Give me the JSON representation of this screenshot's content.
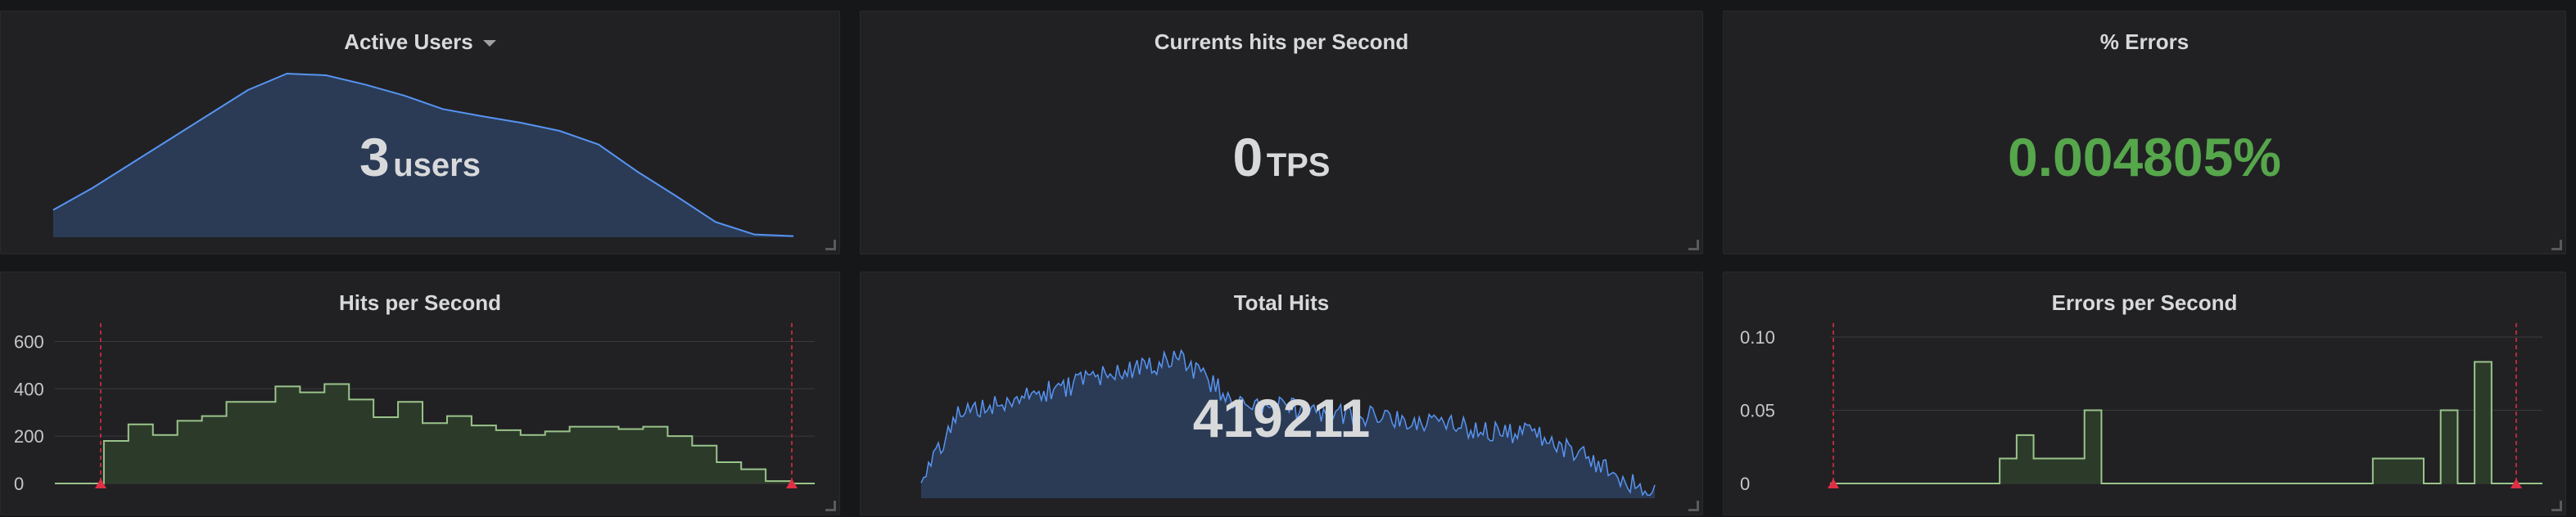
{
  "panels": {
    "active_users": {
      "title": "Active Users",
      "value": "3",
      "unit": "users"
    },
    "current_hits": {
      "title": "Currents hits per Second",
      "value": "0",
      "unit": "TPS"
    },
    "errors_pct": {
      "title": "% Errors",
      "value": "0.004805%",
      "color": "#56a64b"
    },
    "hits_per_second": {
      "title": "Hits per Second"
    },
    "total_hits": {
      "title": "Total Hits",
      "value": "419211"
    },
    "errors_per_second": {
      "title": "Errors per Second"
    }
  },
  "colors": {
    "sparkline_line": "#5794f2",
    "sparkline_fill": "#2b3b55",
    "graph_line": "#9ac48a",
    "graph_fill": "#2c3a2a",
    "annotation": "#e02f44",
    "grid": "#3a3a3d"
  },
  "chart_data": [
    {
      "type": "area",
      "name": "active_users_sparkline",
      "y": [
        0.5,
        0.9,
        1.35,
        1.8,
        2.25,
        2.7,
        3.0,
        2.97,
        2.8,
        2.6,
        2.35,
        2.22,
        2.1,
        1.95,
        1.7,
        1.2,
        0.75,
        0.28,
        0.05,
        0.02
      ]
    },
    {
      "type": "line",
      "title": "Hits per Second",
      "ylim": [
        0,
        650
      ],
      "yticks": [
        "600",
        "400",
        "200",
        "0"
      ],
      "ytick_values": [
        600,
        400,
        200,
        0
      ],
      "y": [
        0,
        0,
        180,
        250,
        205,
        265,
        285,
        345,
        345,
        410,
        385,
        420,
        355,
        280,
        345,
        255,
        285,
        245,
        225,
        205,
        220,
        240,
        240,
        230,
        240,
        200,
        160,
        90,
        60,
        10,
        0
      ],
      "annotations": [
        "start",
        "end"
      ]
    },
    {
      "type": "area",
      "name": "total_hits_sparkline",
      "description_samples": 300
    },
    {
      "type": "line",
      "title": "Errors per Second",
      "ylim": [
        0,
        0.105
      ],
      "yticks": [
        "0.10",
        "0.05",
        "0"
      ],
      "ytick_values": [
        0.1,
        0.05,
        0
      ],
      "y": [
        0,
        0,
        0,
        0,
        0,
        0,
        0,
        0,
        0,
        0,
        0.017,
        0.033,
        0.017,
        0.017,
        0.017,
        0.05,
        0,
        0,
        0,
        0,
        0,
        0,
        0,
        0,
        0,
        0,
        0,
        0,
        0,
        0,
        0,
        0,
        0.017,
        0.017,
        0.017,
        0,
        0.05,
        0,
        0.083,
        0,
        0,
        0
      ],
      "annotations": [
        "start",
        "end"
      ]
    }
  ]
}
